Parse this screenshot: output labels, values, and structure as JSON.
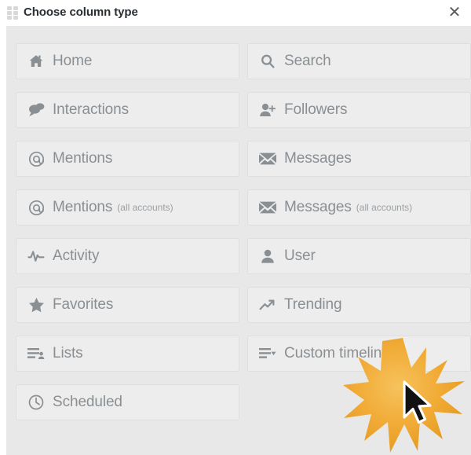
{
  "header": {
    "title": "Choose column type",
    "drag_handle_icon": "drag-dots-icon",
    "close_label": "✕",
    "close_icon": "close-icon"
  },
  "colors": {
    "panel_background": "#e8e8e8",
    "button_background": "#ededed",
    "button_border": "#dedede",
    "label_text": "#8a8f93",
    "title_text": "#292f33",
    "burst_accent": "#f0a830"
  },
  "options": [
    {
      "label": "Home",
      "sub": "",
      "icon": "home-icon"
    },
    {
      "label": "Search",
      "sub": "",
      "icon": "search-icon"
    },
    {
      "label": "Interactions",
      "sub": "",
      "icon": "interactions-icon"
    },
    {
      "label": "Followers",
      "sub": "",
      "icon": "follower-add-icon"
    },
    {
      "label": "Mentions",
      "sub": "",
      "icon": "at-mention-icon"
    },
    {
      "label": "Messages",
      "sub": "",
      "icon": "envelope-icon"
    },
    {
      "label": "Mentions",
      "sub": "(all accounts)",
      "icon": "at-mention-icon"
    },
    {
      "label": "Messages",
      "sub": "(all accounts)",
      "icon": "envelope-icon"
    },
    {
      "label": "Activity",
      "sub": "",
      "icon": "activity-pulse-icon"
    },
    {
      "label": "User",
      "sub": "",
      "icon": "user-icon"
    },
    {
      "label": "Favorites",
      "sub": "",
      "icon": "star-icon"
    },
    {
      "label": "Trending",
      "sub": "",
      "icon": "trending-arrow-icon"
    },
    {
      "label": "Lists",
      "sub": "",
      "icon": "lists-icon"
    },
    {
      "label": "Custom timeline",
      "sub": "",
      "icon": "custom-timeline-icon"
    },
    {
      "label": "Scheduled",
      "sub": "",
      "icon": "clock-icon"
    }
  ],
  "overlay": {
    "click_burst_icon": "click-burst-icon",
    "cursor_icon": "mouse-cursor-icon"
  }
}
